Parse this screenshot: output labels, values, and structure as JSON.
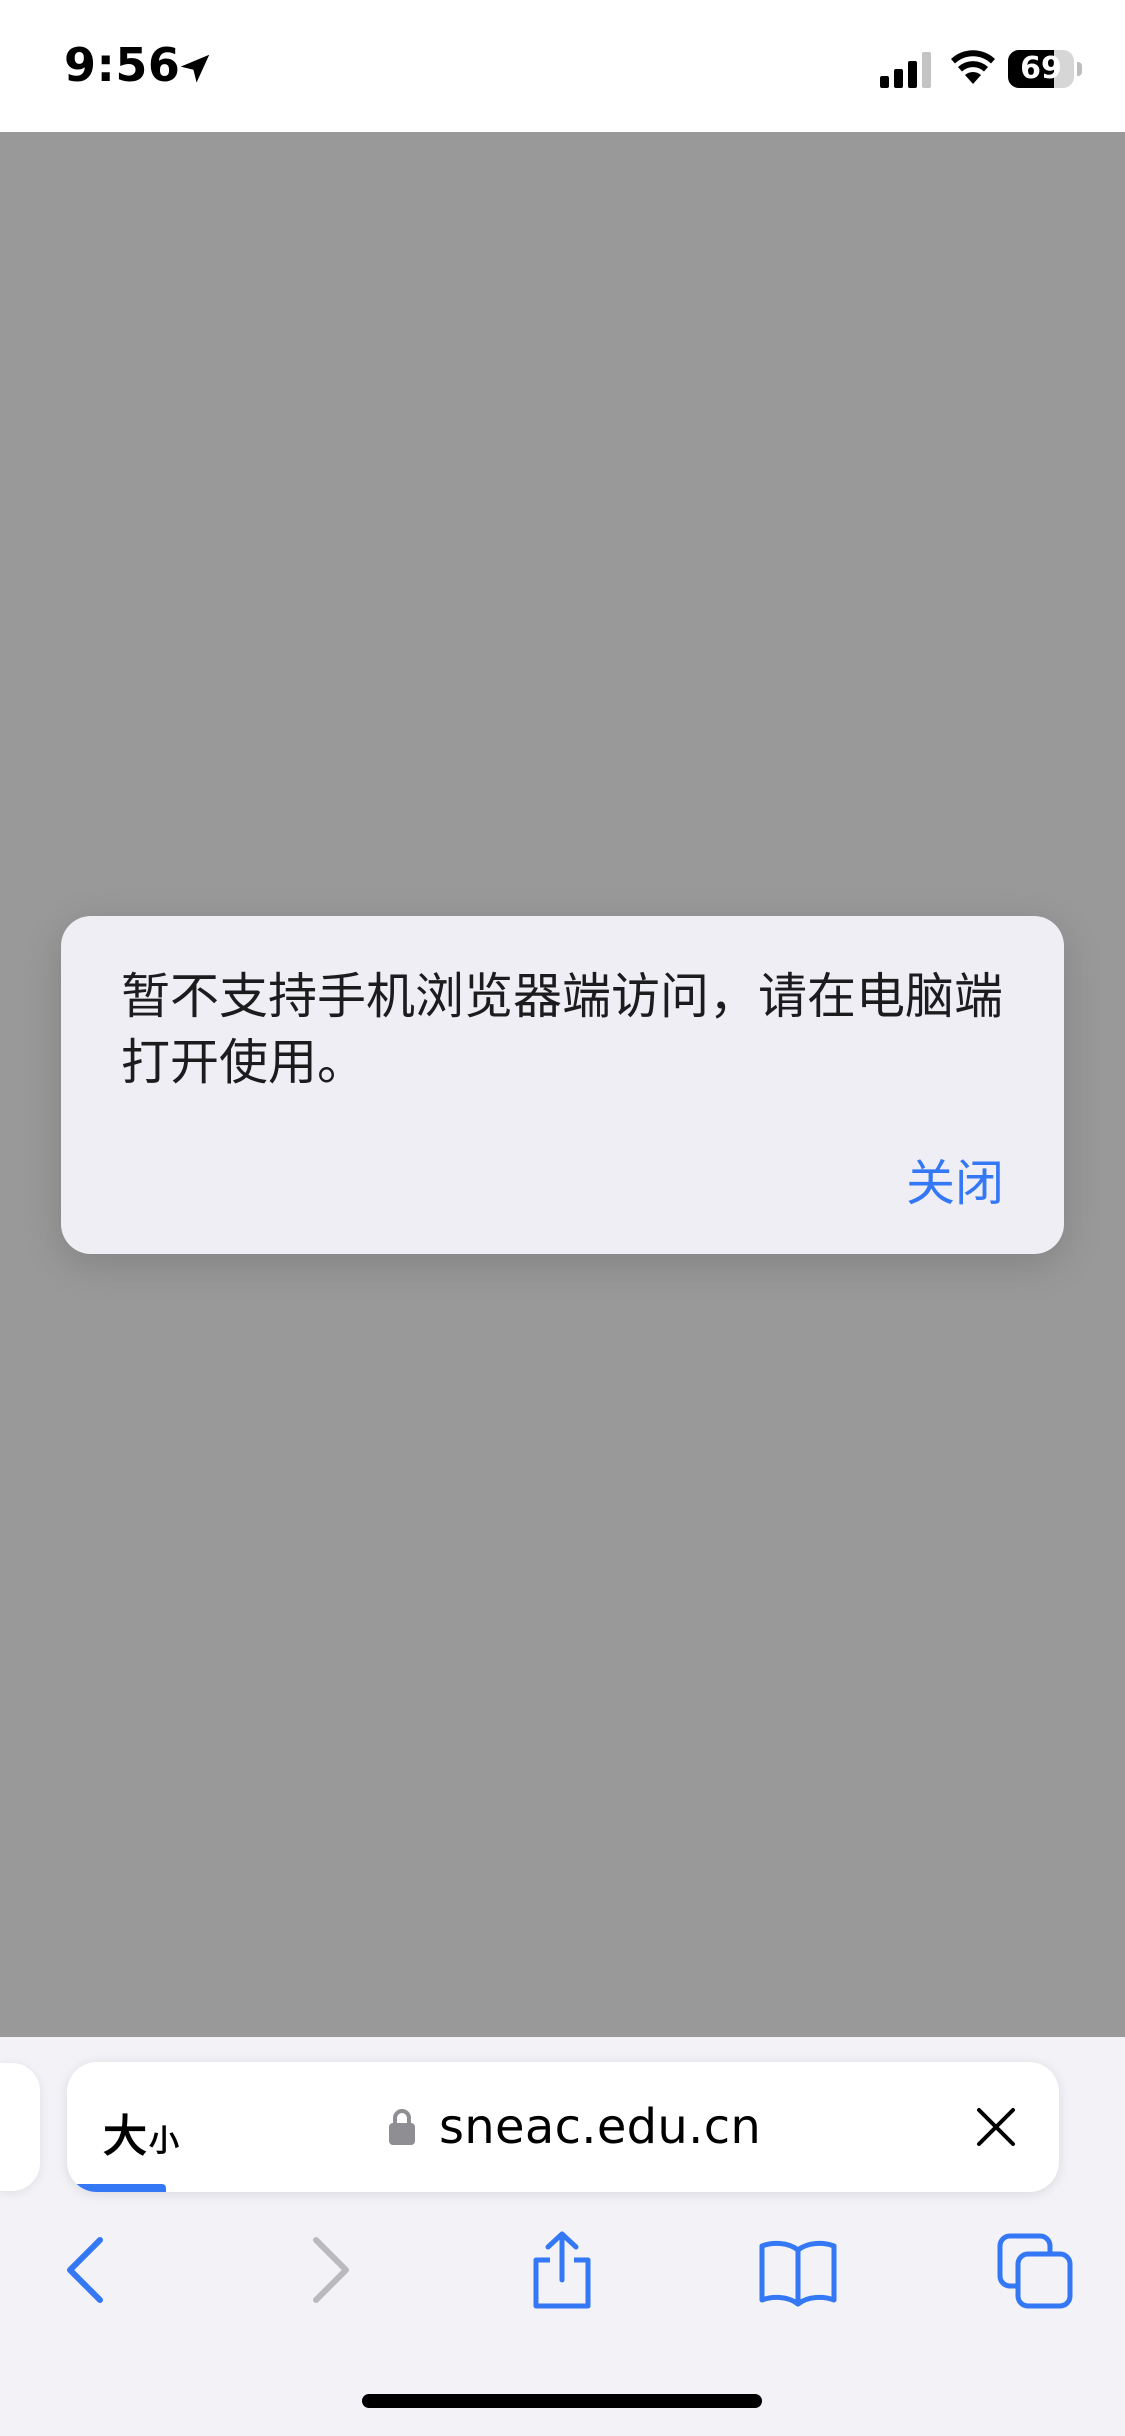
{
  "status_bar": {
    "time": "9:56",
    "battery_text": "69",
    "battery_level": 0.69
  },
  "alert": {
    "message": "暂不支持手机浏览器端访问，请在电脑端打开使用。",
    "close_label": "关闭"
  },
  "address_bar": {
    "text_size_large": "大",
    "text_size_small": "小",
    "url": "sneac.edu.cn",
    "load_progress": 0.1
  },
  "toolbar": {
    "icons": [
      "back-icon",
      "forward-icon",
      "share-icon",
      "bookmarks-icon",
      "tabs-icon"
    ]
  },
  "colors": {
    "accent": "#3478f6",
    "page_dim": "#999999",
    "alert_bg": "#efeef4",
    "toolbar_bg": "#f2f2f7"
  }
}
